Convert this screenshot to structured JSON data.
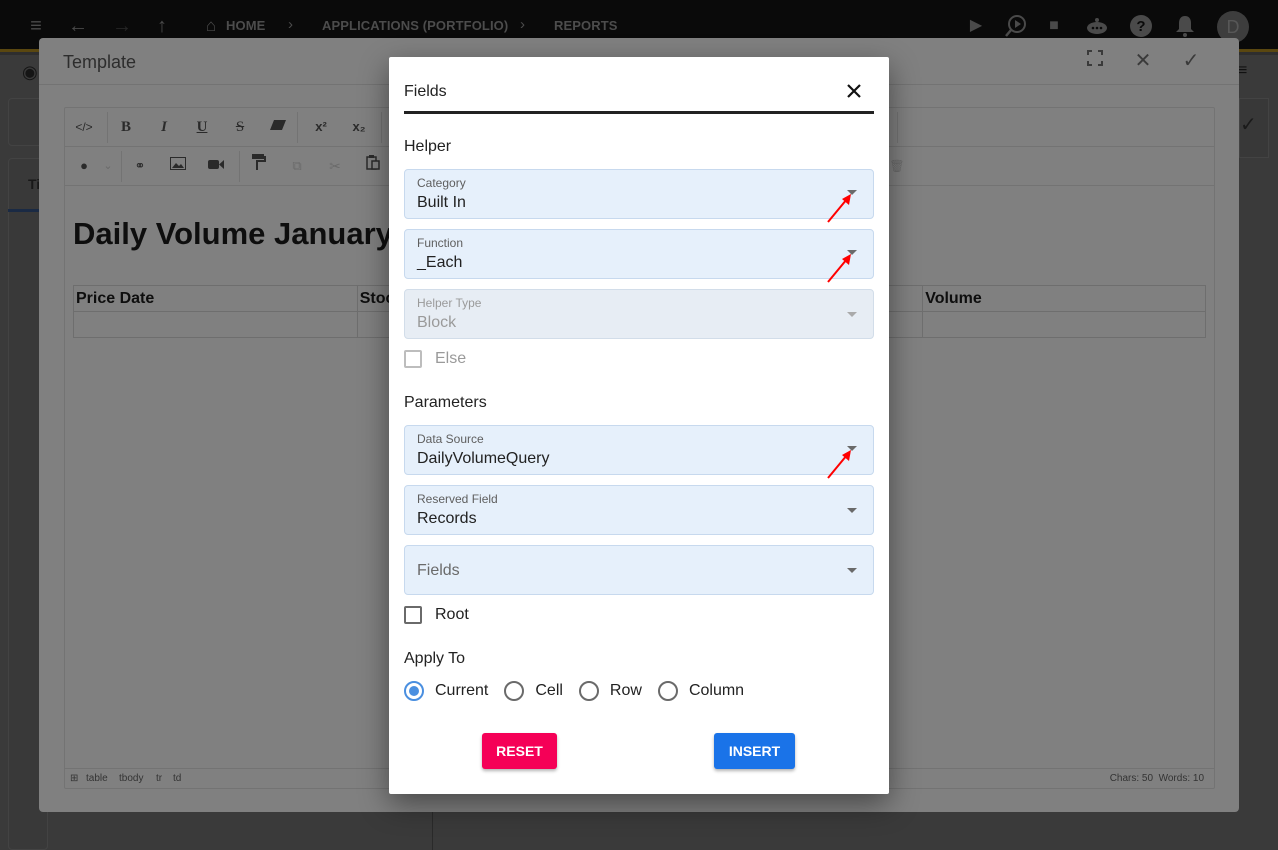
{
  "topbar": {
    "breadcrumbs": [
      "HOME",
      "APPLICATIONS (PORTFOLIO)",
      "REPORTS"
    ],
    "icons": [
      "menu-icon",
      "back-arrow-icon",
      "forward-arrow-icon",
      "up-arrow-icon",
      "home-icon",
      "play-icon",
      "search-play-icon",
      "stop-icon",
      "chatbot-icon",
      "help-icon",
      "notification-bell-icon"
    ],
    "avatar_initial": "D"
  },
  "background": {
    "tab_partial": "Ti"
  },
  "template_dialog": {
    "title": "Template",
    "header_icons": [
      "fullscreen-icon",
      "close-icon",
      "check-icon"
    ],
    "toolbar": {
      "row1": [
        "source-code",
        "bold",
        "italic",
        "underline",
        "strikethrough",
        "eraser",
        "superscript",
        "subscript"
      ],
      "row2": [
        "text-color",
        "color-dropdown",
        "link",
        "image",
        "video",
        "format-painter",
        "copy",
        "cut",
        "paste",
        "delete"
      ],
      "labels": {
        "bold": "B",
        "italic": "I",
        "underline": "U",
        "strike": "S",
        "sup": "x²",
        "sub": "x₂",
        "code": "</>"
      }
    },
    "document": {
      "heading": "Daily Volume January",
      "table_headers": [
        "Price Date",
        "Stock",
        "",
        "Volume"
      ]
    },
    "status": {
      "path": [
        "table",
        "tbody",
        "tr",
        "td"
      ],
      "chars": "Chars: 50",
      "words": "Words: 10"
    }
  },
  "fields_modal": {
    "title": "Fields",
    "helper_section": "Helper",
    "category": {
      "label": "Category",
      "value": "Built In"
    },
    "function": {
      "label": "Function",
      "value": "_Each"
    },
    "helper_type": {
      "label": "Helper Type",
      "value": "Block",
      "disabled": true
    },
    "else_checkbox": {
      "label": "Else",
      "checked": false,
      "disabled": true
    },
    "parameters_section": "Parameters",
    "data_source": {
      "label": "Data Source",
      "value": "DailyVolumeQuery"
    },
    "reserved_field": {
      "label": "Reserved Field",
      "value": "Records"
    },
    "fields_select": {
      "placeholder": "Fields",
      "value": ""
    },
    "root_checkbox": {
      "label": "Root",
      "checked": false
    },
    "apply_to_section": "Apply To",
    "apply_to_options": [
      {
        "label": "Current",
        "selected": true
      },
      {
        "label": "Cell",
        "selected": false
      },
      {
        "label": "Row",
        "selected": false
      },
      {
        "label": "Column",
        "selected": false
      }
    ],
    "reset_label": "RESET",
    "insert_label": "INSERT",
    "colors": {
      "reset": "#f50057",
      "insert": "#1a73e8",
      "radio_selected": "#4a8fe0",
      "annotation_arrow": "#ff0000"
    }
  }
}
